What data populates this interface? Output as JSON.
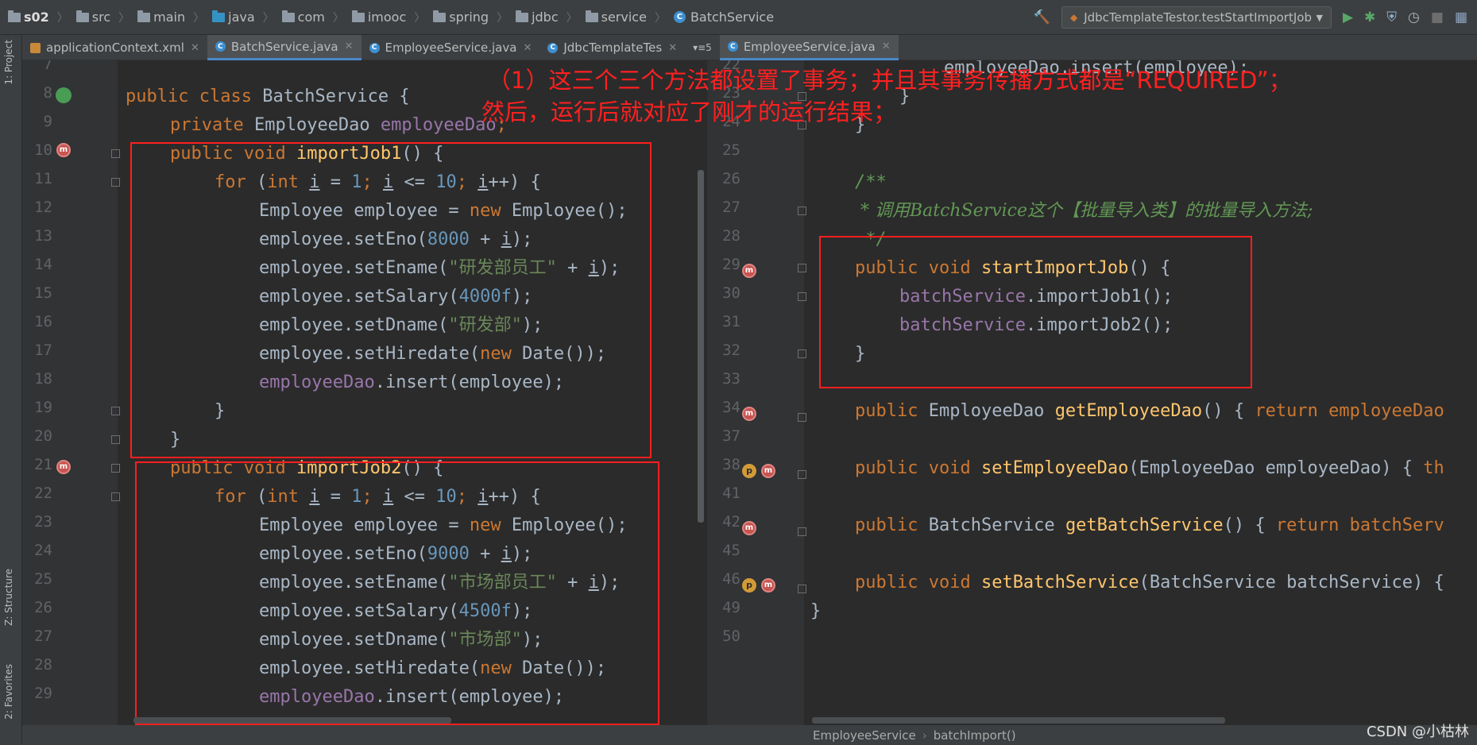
{
  "breadcrumb": [
    "s02",
    "src",
    "main",
    "java",
    "com",
    "imooc",
    "spring",
    "jdbc",
    "service",
    "BatchService"
  ],
  "run_config": "JdbcTemplateTestor.testStartImportJob",
  "tabs": [
    {
      "label": "applicationContext.xml",
      "icon": "xml-file-icon"
    },
    {
      "label": "BatchService.java",
      "icon": "java-class-icon",
      "active": true
    },
    {
      "label": "EmployeeService.java",
      "icon": "java-class-icon"
    },
    {
      "label": "JdbcTemplateTes",
      "icon": "java-class-icon"
    },
    {
      "label": "5",
      "icon": "tab-overflow-icon"
    },
    {
      "label": "EmployeeService.java",
      "icon": "java-class-icon",
      "active": true
    }
  ],
  "left_strip": {
    "project": "1: Project",
    "structure": "Z: Structure",
    "favorites": "2: Favorites"
  },
  "left_lines": [
    "7",
    "8",
    "9",
    "10",
    "11",
    "12",
    "13",
    "14",
    "15",
    "16",
    "17",
    "18",
    "19",
    "20",
    "21",
    "22",
    "23",
    "24",
    "25",
    "26",
    "27",
    "28",
    "29"
  ],
  "left_code": {
    "l8a": "public",
    "l8b": "class",
    "l8c": "BatchService {",
    "l9a": "private",
    "l9b": "EmployeeDao",
    "l9c": "employeeDao",
    "l10a": "public void",
    "l10b": "importJob1",
    "l10c": "() {",
    "for_kw": "for",
    "int_kw": "int",
    "i": "i",
    "one": "1",
    "ten": "10",
    "emp_new": "Employee employee = ",
    "new_kw": "new",
    "emp_ctor": "Employee();",
    "set_eno": "employee.setEno(",
    "eno1": "8000",
    "eno2": "9000",
    "set_ename": "employee.setEname(",
    "ename1": "\"研发部员工\"",
    "ename2": "\"市场部员工\"",
    "set_salary": "employee.setSalary(",
    "sal1": "4000f",
    "sal2": "4500f",
    "set_dname": "employee.setDname(",
    "dname1": "\"研发部\"",
    "dname2": "\"市场部\"",
    "set_hire": "employee.setHiredate(",
    "date_ctor": "Date());",
    "dao": "employeeDao",
    "insert": ".insert(employee);",
    "l21b": "importJob2"
  },
  "right_lines": [
    "22",
    "23",
    "24",
    "25",
    "26",
    "27",
    "28",
    "29",
    "30",
    "31",
    "32",
    "33",
    "34",
    "37",
    "38",
    "41",
    "42",
    "45",
    "46",
    "49",
    "50"
  ],
  "right_code": {
    "l22": "employeeDao.insert(employee);",
    "doc_open": "/**",
    "doc_body": " * 调用BatchService这个【批量导入类】的批量导入方法;",
    "doc_close": " */",
    "m_start": "startImportJob",
    "bs": "batchService",
    "call1": ".importJob1();",
    "call2": ".importJob2();",
    "get_dao": "getEmployeeDao",
    "ret_dao": "return employeeDao",
    "set_dao": "setEmployeeDao",
    "set_dao_param": "(EmployeeDao employeeDao)",
    "th": "th",
    "get_bs": "getBatchService",
    "ret_bs": "return batchServ",
    "set_bs": "setBatchService",
    "set_bs_param": "(BatchService batchService)"
  },
  "annotation": {
    "line1": "（1）这三个三个方法都设置了事务；并且其事务传播方式都是“REQUIRED”；",
    "line2": "然后，运行后就对应了刚才的运行结果；"
  },
  "status": {
    "crumb1": "EmployeeService",
    "crumb2": "batchImport()"
  },
  "watermark": "CSDN @小枯林"
}
